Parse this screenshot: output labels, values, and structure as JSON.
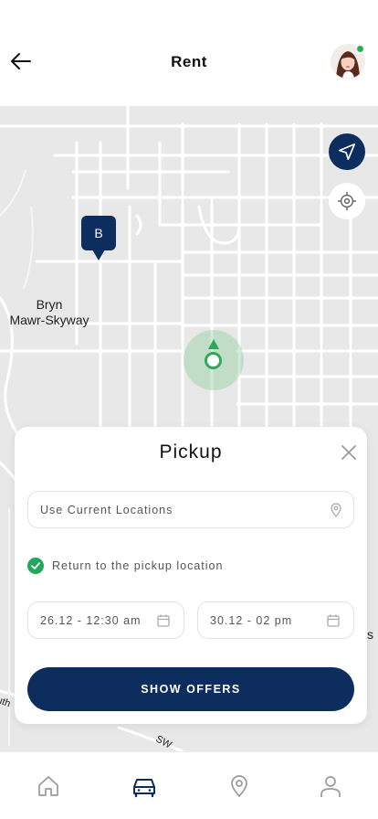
{
  "header": {
    "title": "Rent",
    "back_icon": "arrow-left-icon",
    "avatar_status": "online"
  },
  "map": {
    "labels": {
      "neighborhood": "Bryn\nMawr-Skyway",
      "edge_right": "s",
      "edge_left": "uth",
      "street": "SW"
    },
    "marker_label": "B",
    "controls": {
      "navigate_icon": "navigation-arrow-icon",
      "locate_icon": "crosshair-icon"
    }
  },
  "sheet": {
    "title": "Pickup",
    "location_placeholder": "Use Current Locations",
    "return_label": "Return to the pickup location",
    "return_checked": true,
    "pickup_datetime": "26.12 - 12:30 am",
    "return_datetime": "30.12 - 02 pm",
    "button_label": "SHOW OFFERS"
  },
  "tabs": [
    {
      "name": "home",
      "icon": "home-icon",
      "active": false
    },
    {
      "name": "rent",
      "icon": "car-icon",
      "active": true
    },
    {
      "name": "locations",
      "icon": "map-pin-icon",
      "active": false
    },
    {
      "name": "profile",
      "icon": "user-icon",
      "active": false
    }
  ],
  "colors": {
    "primary": "#0c2d5e",
    "success": "#22a85a",
    "map_bg": "#e8e8e8",
    "inactive_icon": "#9a9a9a"
  }
}
